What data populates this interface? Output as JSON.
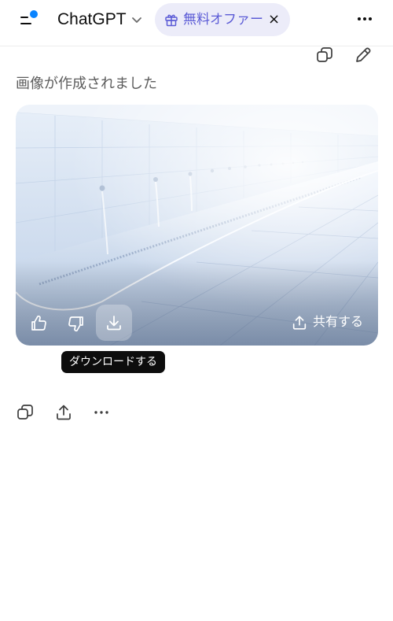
{
  "header": {
    "app_title": "ChatGPT",
    "offer_label": "無料オファー",
    "offer_close": "×"
  },
  "message": {
    "status_text": "画像が作成されました"
  },
  "image_overlay": {
    "share_label": "共有する"
  },
  "tooltip": {
    "download_text": "ダウンロードする"
  },
  "colors": {
    "accent": "#0a84ff",
    "offer_bg": "#ececf9",
    "offer_text": "#5b5bd6",
    "tooltip_bg": "#0d0d0d"
  },
  "icons": [
    "menu-icon",
    "chevron-down-icon",
    "gift-icon",
    "close-icon",
    "more-icon",
    "copy-icon",
    "edit-icon",
    "thumbs-up-icon",
    "thumbs-down-icon",
    "download-icon",
    "share-icon"
  ]
}
